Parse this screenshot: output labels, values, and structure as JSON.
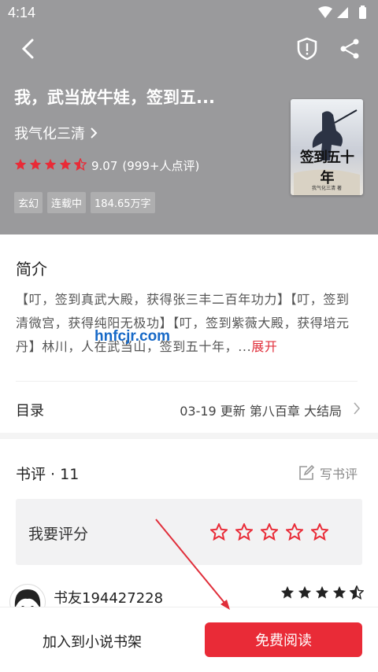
{
  "status_bar": {
    "time": "4:14"
  },
  "header": {
    "title": "我，武当放牛娃，签到五...",
    "author": "我气化三清",
    "rating_value": "9.07",
    "rating_count": "(999+人点评)",
    "rating_stars": 4.5,
    "tags": [
      "玄幻",
      "连载中",
      "184.65万字"
    ],
    "cover_text": "签到五十年",
    "cover_small": "我气化三清 著"
  },
  "intro": {
    "title": "简介",
    "text": "【叮，签到真武大殿，获得张三丰二百年功力】【叮，签到清微宫，获得纯阳无极功】【叮，签到紫薇大殿，获得培元丹】林川，人在武当山，签到五十年，...",
    "more_label": "展开"
  },
  "catalog": {
    "label": "目录",
    "date": "03-19",
    "update_label": "更新",
    "latest_chapter": "第八百章 大结局"
  },
  "reviews": {
    "title": "书评 · 11",
    "write_label": "写书评",
    "rate_prompt": "我要评分",
    "first_user": "书友194427228",
    "first_user_stars": 4.5
  },
  "bottom_bar": {
    "add_shelf_label": "加入到小说书架",
    "read_label": "免费阅读"
  },
  "watermark": "hnfcjr.com",
  "colors": {
    "accent": "#e92b37",
    "header_bg": "#9a9a9c",
    "link": "#e02e3a",
    "watermark": "#1769c7"
  }
}
